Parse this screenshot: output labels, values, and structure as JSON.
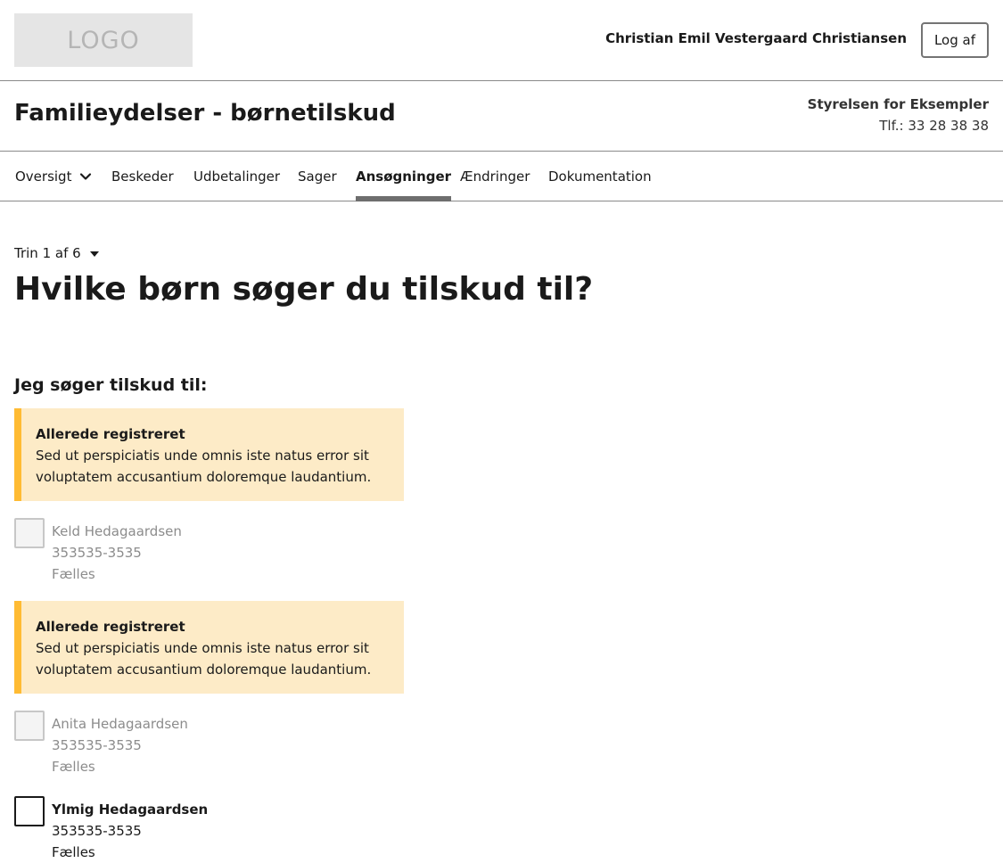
{
  "top": {
    "logo_text": "LOGO",
    "user_name": "Christian Emil Vestergaard Christiansen",
    "logout_label": "Log af"
  },
  "header": {
    "title": "Familieydelser - børnetilskud",
    "authority_name": "Styrelsen for Eksempler",
    "authority_phone": "Tlf.: 33 28 38 38"
  },
  "nav": {
    "items": [
      {
        "label": "Oversigt"
      },
      {
        "label": "Beskeder"
      },
      {
        "label": "Udbetalinger"
      },
      {
        "label": "Sager"
      },
      {
        "label": "Ansøgninger"
      },
      {
        "label": "Ændringer"
      },
      {
        "label": "Dokumentation"
      }
    ],
    "active": "Ansøgninger"
  },
  "main": {
    "step": "Trin 1 af 6",
    "title": "Hvilke børn søger du tilskud til?",
    "legend": "Jeg søger tilskud til:",
    "alerts": [
      {
        "title": "Allerede registreret",
        "text_line1": "Sed ut perspiciatis unde omnis iste natus error sit",
        "text_line2": "voluptatem accusantium doloremque laudantium."
      },
      {
        "title": "Allerede registreret",
        "text_line1": "Sed ut perspiciatis unde omnis iste natus error sit",
        "text_line2": "voluptatem accusantium doloremque laudantium."
      }
    ],
    "children": [
      {
        "name": "Keld Hedagaardsen",
        "cpr": "353535-3535",
        "custody": "Fælles",
        "disabled": true,
        "checked": false
      },
      {
        "name": "Anita Hedagaardsen",
        "cpr": "353535-3535",
        "custody": "Fælles",
        "disabled": true,
        "checked": false
      },
      {
        "name": "Ylmig Hedagaardsen",
        "cpr": "353535-3535",
        "custody": "Fælles",
        "disabled": false,
        "checked": false
      }
    ]
  },
  "colors": {
    "alert_background": "#fdebc7",
    "alert_border": "#ffbb33",
    "active_tab_indicator": "#6e6e6e"
  }
}
